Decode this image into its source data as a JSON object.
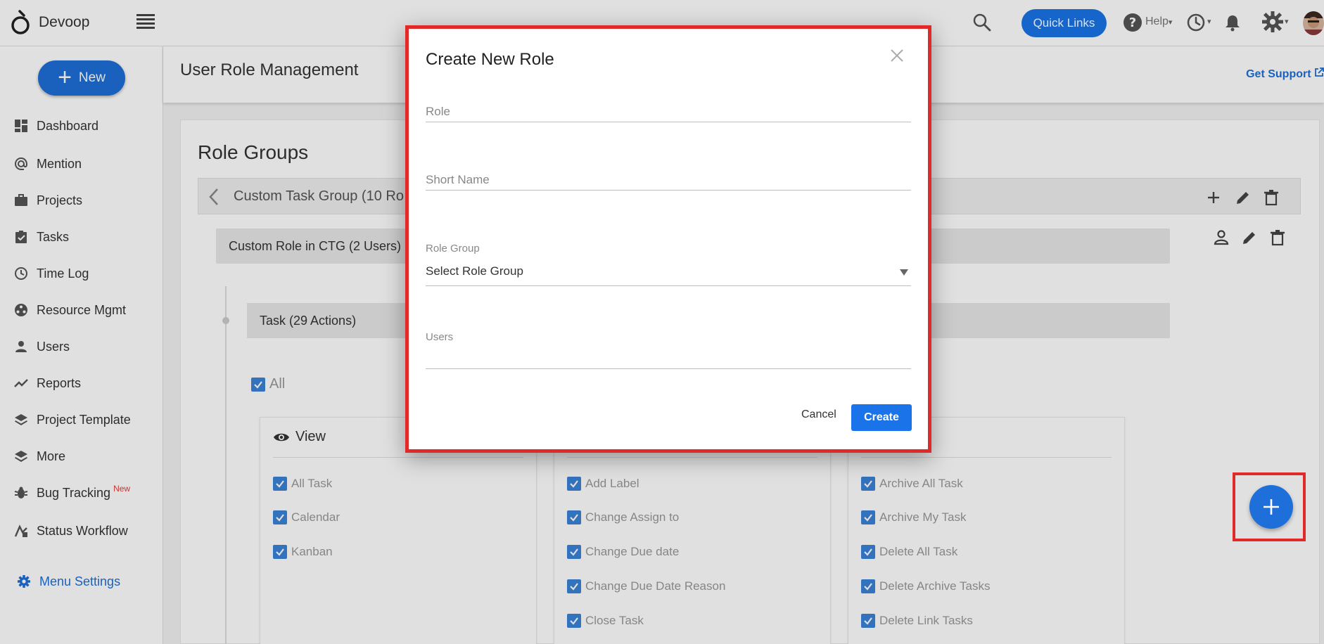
{
  "app": {
    "brand": "Devoop"
  },
  "topbar": {
    "quick_links": "Quick Links",
    "help": "Help",
    "caret": "▾"
  },
  "sidebar": {
    "new_label": "New",
    "items": [
      {
        "label": "Dashboard",
        "icon": "dashboard-icon"
      },
      {
        "label": "Mention",
        "icon": "at-icon"
      },
      {
        "label": "Projects",
        "icon": "briefcase-icon"
      },
      {
        "label": "Tasks",
        "icon": "clipboard-icon"
      },
      {
        "label": "Time Log",
        "icon": "clock-icon"
      },
      {
        "label": "Resource Mgmt",
        "icon": "resource-icon"
      },
      {
        "label": "Users",
        "icon": "user-icon"
      },
      {
        "label": "Reports",
        "icon": "trend-icon"
      },
      {
        "label": "Project Template",
        "icon": "layers-icon"
      },
      {
        "label": "More",
        "icon": "layers-icon"
      },
      {
        "label": "Bug Tracking",
        "icon": "bug-icon",
        "badge": "New"
      },
      {
        "label": "Status Workflow",
        "icon": "workflow-icon"
      }
    ],
    "menu_settings": "Menu Settings"
  },
  "page": {
    "title": "User Role Management",
    "support": "Get Support",
    "section_title": "Role Groups",
    "group_title": "Custom Task Group   (10 Ro",
    "role_title": "Custom Role in CTG  (2 Users)",
    "task_title": "Task  (29 Actions)",
    "all_label": "All",
    "columns": [
      {
        "heading": "View",
        "items": [
          "All Task",
          "Calendar",
          "Kanban"
        ]
      },
      {
        "heading": "",
        "items": [
          "Add Label",
          "Change Assign to",
          "Change Due date",
          "Change Due Date Reason",
          "Close Task"
        ]
      },
      {
        "heading": "",
        "items": [
          "Archive All Task",
          "Archive My Task",
          "Delete All Task",
          "Delete Archive Tasks",
          "Delete Link Tasks"
        ]
      }
    ]
  },
  "modal": {
    "title": "Create New Role",
    "role_placeholder": "Role",
    "short_name_placeholder": "Short Name",
    "role_group_label": "Role Group",
    "role_group_value": "Select Role Group",
    "users_label": "Users",
    "cancel": "Cancel",
    "create": "Create"
  },
  "colors": {
    "primary": "#1e6fd9",
    "highlight": "#e02a2a"
  }
}
